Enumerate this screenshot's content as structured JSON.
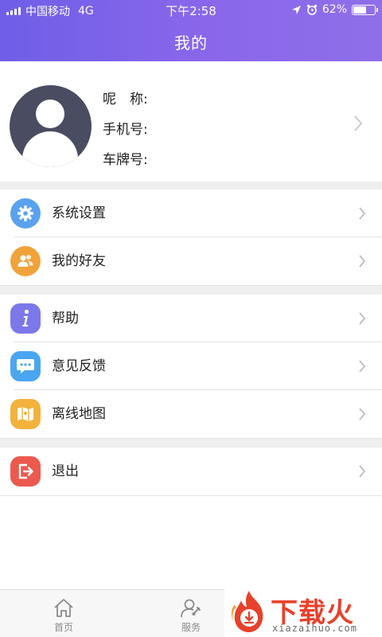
{
  "status": {
    "carrier": "中国移动",
    "network": "4G",
    "time": "下午2:58",
    "battery": "62%",
    "battery_level": 0.62
  },
  "header": {
    "title": "我的"
  },
  "profile": {
    "nickname_label": "呢　称:",
    "phone_label": "手机号:",
    "plate_label": "车牌号:",
    "avatar_icon": "avatar-placeholder-icon"
  },
  "menu": {
    "settings": {
      "label": "系统设置",
      "icon": "gear-icon",
      "color": "#5aa2ef"
    },
    "friends": {
      "label": "我的好友",
      "icon": "friends-icon",
      "color": "#f0a33a"
    },
    "help": {
      "label": "帮助",
      "icon": "info-icon",
      "color": "#7c78ea"
    },
    "feedback": {
      "label": "意见反馈",
      "icon": "chat-bubble-icon",
      "color": "#4aa6f0"
    },
    "offline_map": {
      "label": "离线地图",
      "icon": "map-icon",
      "color": "#f3b23c"
    },
    "logout": {
      "label": "退出",
      "icon": "logout-icon",
      "color": "#ec5a4f"
    }
  },
  "tabbar": {
    "home": "首页",
    "service": "服务"
  },
  "watermark": {
    "brand": "下载火",
    "domain": "xiazaihuo.com"
  },
  "colors": {
    "header_start": "#6f5ee8",
    "header_end": "#8e6fe9",
    "avatar_bg": "#4a4d61",
    "watermark_red": "#e8412b"
  }
}
